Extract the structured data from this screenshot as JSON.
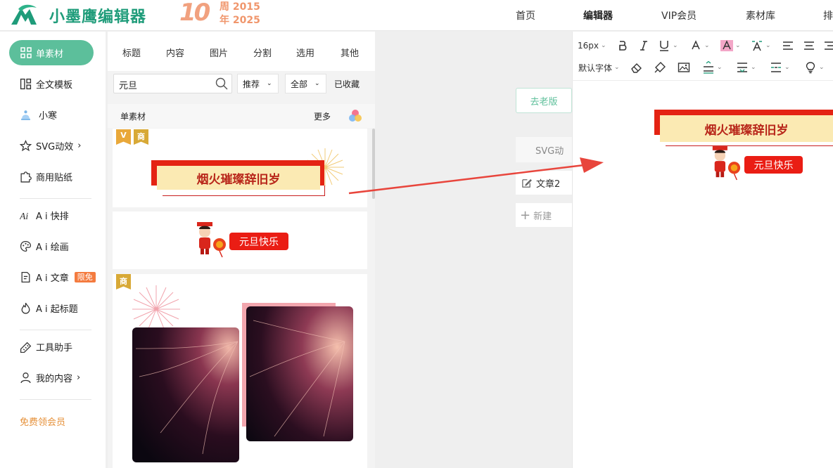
{
  "brand": {
    "name": "小墨鹰编辑器",
    "anniversary_number": "10",
    "anniversary_line1": "周 2015",
    "anniversary_line2": "年 2025"
  },
  "nav": [
    "首页",
    "编辑器",
    "VIP会员",
    "素材库",
    "排"
  ],
  "sidebar": {
    "items": [
      {
        "label": "单素材",
        "icon": "grid-icon"
      },
      {
        "label": "全文模板",
        "icon": "template-icon"
      },
      {
        "label": "小寒",
        "icon": "snow-hat-icon"
      },
      {
        "label": "SVG动效",
        "icon": "star-icon",
        "suffix": "›"
      },
      {
        "label": "商用贴纸",
        "icon": "puzzle-icon"
      },
      {
        "label": "A i 快排",
        "icon": "ai-icon"
      },
      {
        "label": "A i 绘画",
        "icon": "palette-icon"
      },
      {
        "label": "A i 文章",
        "icon": "document-icon",
        "badge": "限免"
      },
      {
        "label": "A i 起标题",
        "icon": "flame-icon"
      },
      {
        "label": "工具助手",
        "icon": "ruler-icon"
      },
      {
        "label": "我的内容",
        "icon": "user-icon",
        "suffix": "›"
      }
    ],
    "member_link": "免费领会员"
  },
  "material_panel": {
    "tabs": [
      "标题",
      "内容",
      "图片",
      "分割",
      "选用",
      "其他"
    ],
    "search": {
      "value": "元旦"
    },
    "filter_sort": "推荐",
    "filter_scope": "全部",
    "collected": "已收藏",
    "section_title": "单素材",
    "section_more": "更多",
    "card1": {
      "tag_v": "V",
      "tag_s": "商",
      "title": "烟火璀璨辞旧岁"
    },
    "card2": {
      "label": "元旦快乐"
    },
    "card3": {
      "tag_s": "商"
    }
  },
  "middle": {
    "old_version": "去老版",
    "svg_btn": "SVG动",
    "doc_name": "文章2",
    "new_btn": "新建"
  },
  "editor": {
    "font_size": "16px",
    "default_font": "默认字体",
    "banner_title": "烟火璀璨辞旧岁",
    "greeting": "元旦快乐"
  },
  "colors": {
    "brand_green": "#1f9c7a",
    "accent_green": "#5cbf9b",
    "banner_red": "#e42313",
    "banner_cream": "#fbeab3"
  }
}
